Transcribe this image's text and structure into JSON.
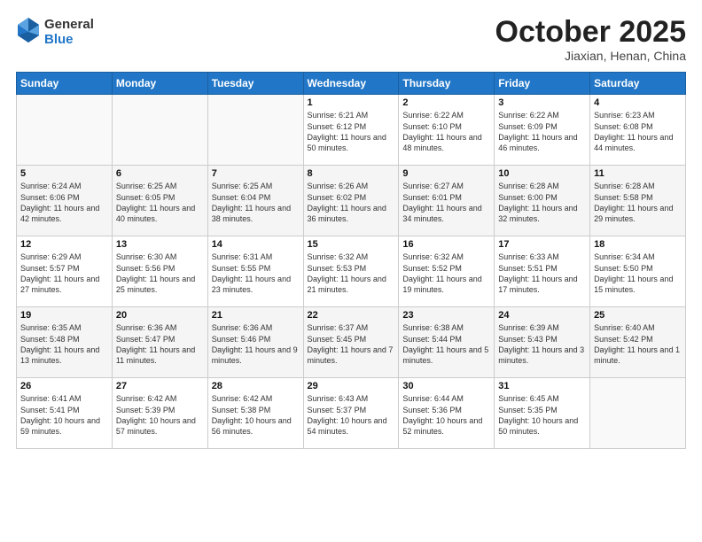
{
  "header": {
    "logo_general": "General",
    "logo_blue": "Blue",
    "month": "October 2025",
    "location": "Jiaxian, Henan, China"
  },
  "days_of_week": [
    "Sunday",
    "Monday",
    "Tuesday",
    "Wednesday",
    "Thursday",
    "Friday",
    "Saturday"
  ],
  "weeks": [
    [
      {
        "num": "",
        "sunrise": "",
        "sunset": "",
        "daylight": ""
      },
      {
        "num": "",
        "sunrise": "",
        "sunset": "",
        "daylight": ""
      },
      {
        "num": "",
        "sunrise": "",
        "sunset": "",
        "daylight": ""
      },
      {
        "num": "1",
        "sunrise": "Sunrise: 6:21 AM",
        "sunset": "Sunset: 6:12 PM",
        "daylight": "Daylight: 11 hours and 50 minutes."
      },
      {
        "num": "2",
        "sunrise": "Sunrise: 6:22 AM",
        "sunset": "Sunset: 6:10 PM",
        "daylight": "Daylight: 11 hours and 48 minutes."
      },
      {
        "num": "3",
        "sunrise": "Sunrise: 6:22 AM",
        "sunset": "Sunset: 6:09 PM",
        "daylight": "Daylight: 11 hours and 46 minutes."
      },
      {
        "num": "4",
        "sunrise": "Sunrise: 6:23 AM",
        "sunset": "Sunset: 6:08 PM",
        "daylight": "Daylight: 11 hours and 44 minutes."
      }
    ],
    [
      {
        "num": "5",
        "sunrise": "Sunrise: 6:24 AM",
        "sunset": "Sunset: 6:06 PM",
        "daylight": "Daylight: 11 hours and 42 minutes."
      },
      {
        "num": "6",
        "sunrise": "Sunrise: 6:25 AM",
        "sunset": "Sunset: 6:05 PM",
        "daylight": "Daylight: 11 hours and 40 minutes."
      },
      {
        "num": "7",
        "sunrise": "Sunrise: 6:25 AM",
        "sunset": "Sunset: 6:04 PM",
        "daylight": "Daylight: 11 hours and 38 minutes."
      },
      {
        "num": "8",
        "sunrise": "Sunrise: 6:26 AM",
        "sunset": "Sunset: 6:02 PM",
        "daylight": "Daylight: 11 hours and 36 minutes."
      },
      {
        "num": "9",
        "sunrise": "Sunrise: 6:27 AM",
        "sunset": "Sunset: 6:01 PM",
        "daylight": "Daylight: 11 hours and 34 minutes."
      },
      {
        "num": "10",
        "sunrise": "Sunrise: 6:28 AM",
        "sunset": "Sunset: 6:00 PM",
        "daylight": "Daylight: 11 hours and 32 minutes."
      },
      {
        "num": "11",
        "sunrise": "Sunrise: 6:28 AM",
        "sunset": "Sunset: 5:58 PM",
        "daylight": "Daylight: 11 hours and 29 minutes."
      }
    ],
    [
      {
        "num": "12",
        "sunrise": "Sunrise: 6:29 AM",
        "sunset": "Sunset: 5:57 PM",
        "daylight": "Daylight: 11 hours and 27 minutes."
      },
      {
        "num": "13",
        "sunrise": "Sunrise: 6:30 AM",
        "sunset": "Sunset: 5:56 PM",
        "daylight": "Daylight: 11 hours and 25 minutes."
      },
      {
        "num": "14",
        "sunrise": "Sunrise: 6:31 AM",
        "sunset": "Sunset: 5:55 PM",
        "daylight": "Daylight: 11 hours and 23 minutes."
      },
      {
        "num": "15",
        "sunrise": "Sunrise: 6:32 AM",
        "sunset": "Sunset: 5:53 PM",
        "daylight": "Daylight: 11 hours and 21 minutes."
      },
      {
        "num": "16",
        "sunrise": "Sunrise: 6:32 AM",
        "sunset": "Sunset: 5:52 PM",
        "daylight": "Daylight: 11 hours and 19 minutes."
      },
      {
        "num": "17",
        "sunrise": "Sunrise: 6:33 AM",
        "sunset": "Sunset: 5:51 PM",
        "daylight": "Daylight: 11 hours and 17 minutes."
      },
      {
        "num": "18",
        "sunrise": "Sunrise: 6:34 AM",
        "sunset": "Sunset: 5:50 PM",
        "daylight": "Daylight: 11 hours and 15 minutes."
      }
    ],
    [
      {
        "num": "19",
        "sunrise": "Sunrise: 6:35 AM",
        "sunset": "Sunset: 5:48 PM",
        "daylight": "Daylight: 11 hours and 13 minutes."
      },
      {
        "num": "20",
        "sunrise": "Sunrise: 6:36 AM",
        "sunset": "Sunset: 5:47 PM",
        "daylight": "Daylight: 11 hours and 11 minutes."
      },
      {
        "num": "21",
        "sunrise": "Sunrise: 6:36 AM",
        "sunset": "Sunset: 5:46 PM",
        "daylight": "Daylight: 11 hours and 9 minutes."
      },
      {
        "num": "22",
        "sunrise": "Sunrise: 6:37 AM",
        "sunset": "Sunset: 5:45 PM",
        "daylight": "Daylight: 11 hours and 7 minutes."
      },
      {
        "num": "23",
        "sunrise": "Sunrise: 6:38 AM",
        "sunset": "Sunset: 5:44 PM",
        "daylight": "Daylight: 11 hours and 5 minutes."
      },
      {
        "num": "24",
        "sunrise": "Sunrise: 6:39 AM",
        "sunset": "Sunset: 5:43 PM",
        "daylight": "Daylight: 11 hours and 3 minutes."
      },
      {
        "num": "25",
        "sunrise": "Sunrise: 6:40 AM",
        "sunset": "Sunset: 5:42 PM",
        "daylight": "Daylight: 11 hours and 1 minute."
      }
    ],
    [
      {
        "num": "26",
        "sunrise": "Sunrise: 6:41 AM",
        "sunset": "Sunset: 5:41 PM",
        "daylight": "Daylight: 10 hours and 59 minutes."
      },
      {
        "num": "27",
        "sunrise": "Sunrise: 6:42 AM",
        "sunset": "Sunset: 5:39 PM",
        "daylight": "Daylight: 10 hours and 57 minutes."
      },
      {
        "num": "28",
        "sunrise": "Sunrise: 6:42 AM",
        "sunset": "Sunset: 5:38 PM",
        "daylight": "Daylight: 10 hours and 56 minutes."
      },
      {
        "num": "29",
        "sunrise": "Sunrise: 6:43 AM",
        "sunset": "Sunset: 5:37 PM",
        "daylight": "Daylight: 10 hours and 54 minutes."
      },
      {
        "num": "30",
        "sunrise": "Sunrise: 6:44 AM",
        "sunset": "Sunset: 5:36 PM",
        "daylight": "Daylight: 10 hours and 52 minutes."
      },
      {
        "num": "31",
        "sunrise": "Sunrise: 6:45 AM",
        "sunset": "Sunset: 5:35 PM",
        "daylight": "Daylight: 10 hours and 50 minutes."
      },
      {
        "num": "",
        "sunrise": "",
        "sunset": "",
        "daylight": ""
      }
    ]
  ]
}
